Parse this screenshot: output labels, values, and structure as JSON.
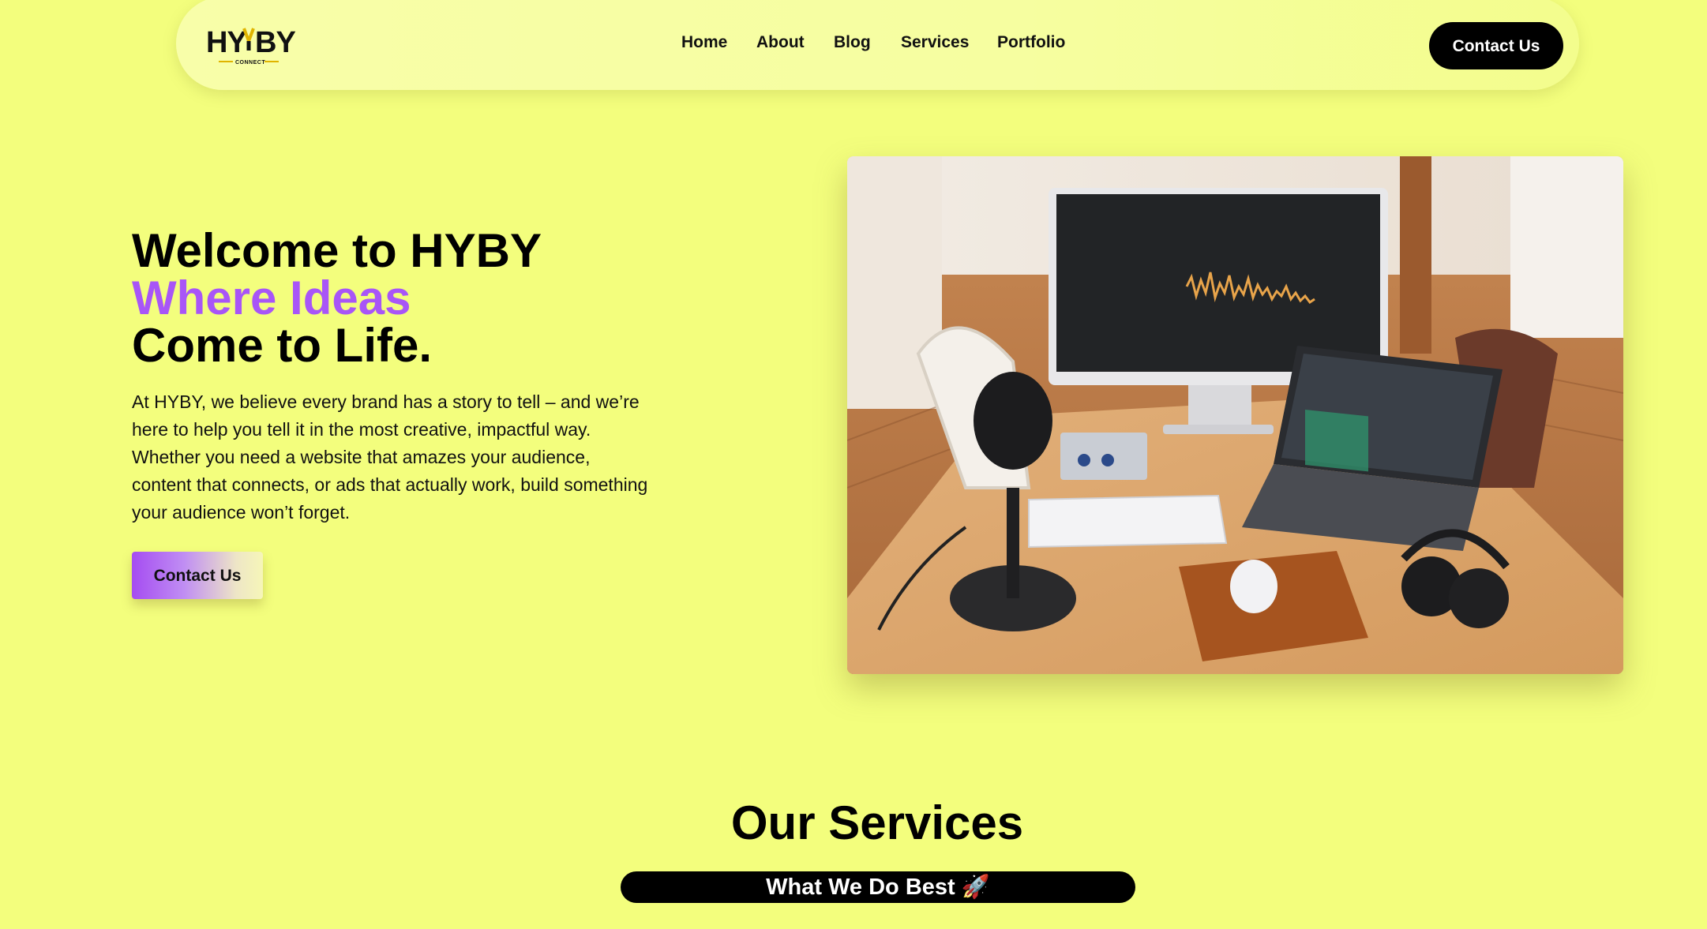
{
  "brand": {
    "name": "HYBY",
    "tagline": "CONNECT",
    "accent_color": "#a855f7",
    "background_color": "#f3fe7d"
  },
  "nav": {
    "items": [
      {
        "label": "Home"
      },
      {
        "label": "About"
      },
      {
        "label": "Blog"
      },
      {
        "label": "Services"
      },
      {
        "label": "Portfolio"
      }
    ],
    "cta_label": "Contact Us"
  },
  "hero": {
    "title_line1": "Welcome to HYBY",
    "title_line2": "Where Ideas",
    "title_line3": "Come to Life.",
    "description": "At HYBY, we believe every brand has a story to tell – and we’re here to help you tell it in the most creative, impactful way. Whether you need a website that amazes your audience, content that connects, or ads that actually work, build something your audience won’t forget.",
    "cta_label": "Contact Us",
    "image_icon": "podcast-studio-photo"
  },
  "services": {
    "title": "Our Services",
    "subtitle": "What We Do Best 🚀"
  }
}
